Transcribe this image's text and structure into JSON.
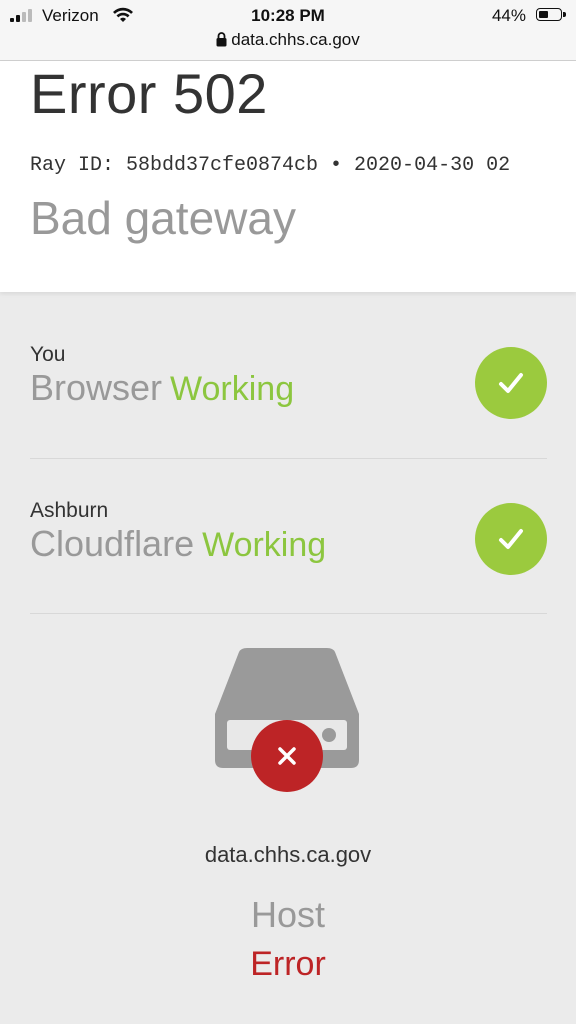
{
  "status_bar": {
    "carrier": "Verizon",
    "time": "10:28 PM",
    "battery": "44%",
    "battery_level": 0.44,
    "icons": [
      "signal-icon",
      "wifi-icon",
      "battery-icon"
    ]
  },
  "url_bar": {
    "url": "data.chhs.ca.gov",
    "icon": "lock-icon"
  },
  "error": {
    "title": "Error 502",
    "ray_id": "Ray ID: 58bdd37cfe0874cb • 2020-04-30 02",
    "description": "Bad gateway"
  },
  "rows": [
    {
      "location": "You",
      "name": "Browser",
      "status": "Working",
      "icon": "check-icon"
    },
    {
      "location": "Ashburn",
      "name": "Cloudflare",
      "status": "Working",
      "icon": "check-icon"
    }
  ],
  "host": {
    "domain": "data.chhs.ca.gov",
    "name": "Host",
    "status": "Error",
    "icons": [
      "server-drive-icon",
      "error-x-icon"
    ]
  },
  "colors": {
    "working": "#8cc63f",
    "error": "#bd2426",
    "check_bg": "#9bca3e",
    "page_bg": "#ebebeb"
  }
}
